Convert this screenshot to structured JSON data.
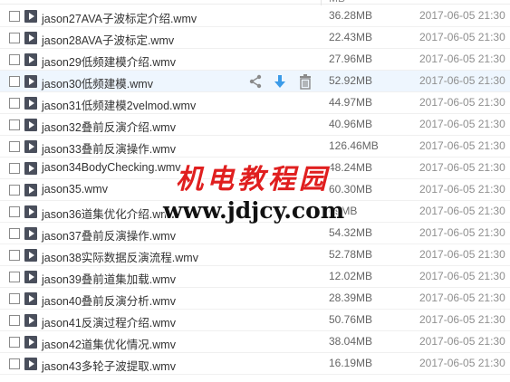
{
  "header": {
    "size_fragment": "MB",
    "date_fragment": ""
  },
  "hover_actions": {
    "share_icon": "share-icon",
    "download_icon": "download-icon",
    "delete_icon": "trash-icon",
    "accent": "#3b9be8"
  },
  "files": [
    {
      "name": "jason27AVA子波标定介绍.wmv",
      "size": "36.28MB",
      "date": "2017-06-05 21:30"
    },
    {
      "name": "jason28AVA子波标定.wmv",
      "size": "22.43MB",
      "date": "2017-06-05 21:30"
    },
    {
      "name": "jason29低频建模介绍.wmv",
      "size": "27.96MB",
      "date": "2017-06-05 21:30"
    },
    {
      "name": "jason30低频建模.wmv",
      "size": "52.92MB",
      "date": "2017-06-05 21:30"
    },
    {
      "name": "jason31低频建模2velmod.wmv",
      "size": "44.97MB",
      "date": "2017-06-05 21:30"
    },
    {
      "name": "jason32叠前反演介绍.wmv",
      "size": "40.96MB",
      "date": "2017-06-05 21:30"
    },
    {
      "name": "jason33叠前反演操作.wmv",
      "size": "126.46MB",
      "date": "2017-06-05 21:30"
    },
    {
      "name": "jason34BodyChecking.wmv",
      "size": "48.24MB",
      "date": "2017-06-05 21:30"
    },
    {
      "name": "jason35.wmv",
      "size": "60.30MB",
      "date": "2017-06-05 21:30"
    },
    {
      "name": "jason36道集优化介绍.wmv",
      "size": "69MB",
      "date": "2017-06-05 21:30"
    },
    {
      "name": "jason37叠前反演操作.wmv",
      "size": "54.32MB",
      "date": "2017-06-05 21:30"
    },
    {
      "name": "jason38实际数据反演流程.wmv",
      "size": "52.78MB",
      "date": "2017-06-05 21:30"
    },
    {
      "name": "jason39叠前道集加载.wmv",
      "size": "12.02MB",
      "date": "2017-06-05 21:30"
    },
    {
      "name": "jason40叠前反演分析.wmv",
      "size": "28.39MB",
      "date": "2017-06-05 21:30"
    },
    {
      "name": "jason41反演过程介绍.wmv",
      "size": "50.76MB",
      "date": "2017-06-05 21:30"
    },
    {
      "name": "jason42道集优化情况.wmv",
      "size": "38.04MB",
      "date": "2017-06-05 21:30"
    },
    {
      "name": "jason43多轮子波提取.wmv",
      "size": "16.19MB",
      "date": "2017-06-05 21:30"
    }
  ],
  "hover_row_index": 3,
  "watermark": {
    "site_name": "机电教程园",
    "url": "www.jdjcy.com"
  }
}
